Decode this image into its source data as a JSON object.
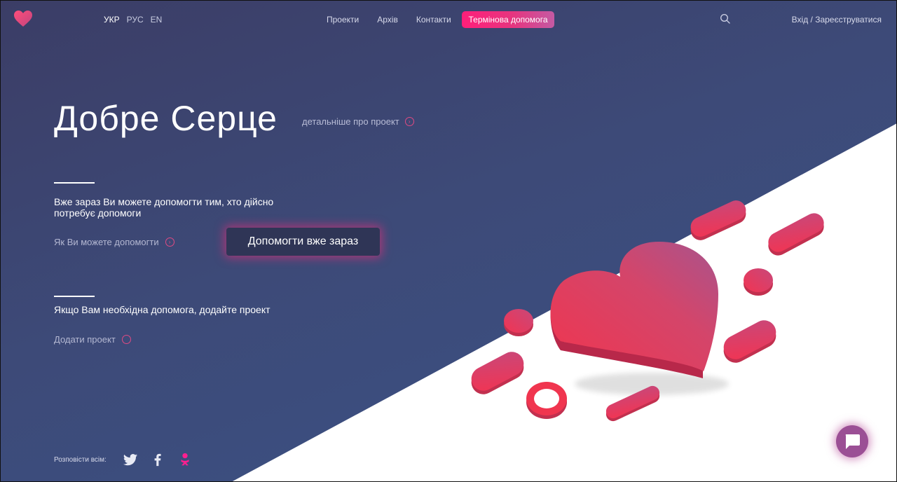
{
  "header": {
    "languages": [
      {
        "label": "УКР",
        "active": true
      },
      {
        "label": "РУС",
        "active": false
      },
      {
        "label": "EN",
        "active": false
      }
    ],
    "nav": [
      "Проекти",
      "Архів",
      "Контакти"
    ],
    "urgent_button": "Термінова допомога",
    "auth_link": "Вхід / Зареєструватися",
    "logo_icon": "heart-logo-icon",
    "search_icon": "search-icon"
  },
  "hero": {
    "title": "Добре Серце",
    "more_link": "детальніше про проект"
  },
  "help_block": {
    "text_line1": "Вже зараз Ви можете допомогти тим, хто дійсно",
    "text_line2": "потребує допомоги",
    "link": "Як Ви можете допомогти",
    "button": "Допомогти вже зараз"
  },
  "project_block": {
    "text": "Якщо Вам необхідна допомога, додайте проект",
    "link": "Додати проект"
  },
  "share": {
    "label": "Розповісти всім:",
    "icons": [
      "twitter-icon",
      "facebook-icon",
      "odnoklassniki-icon"
    ]
  },
  "colors": {
    "accent": "#ff1f7a",
    "heart": "#e6365a",
    "background": "#3d4a78"
  }
}
